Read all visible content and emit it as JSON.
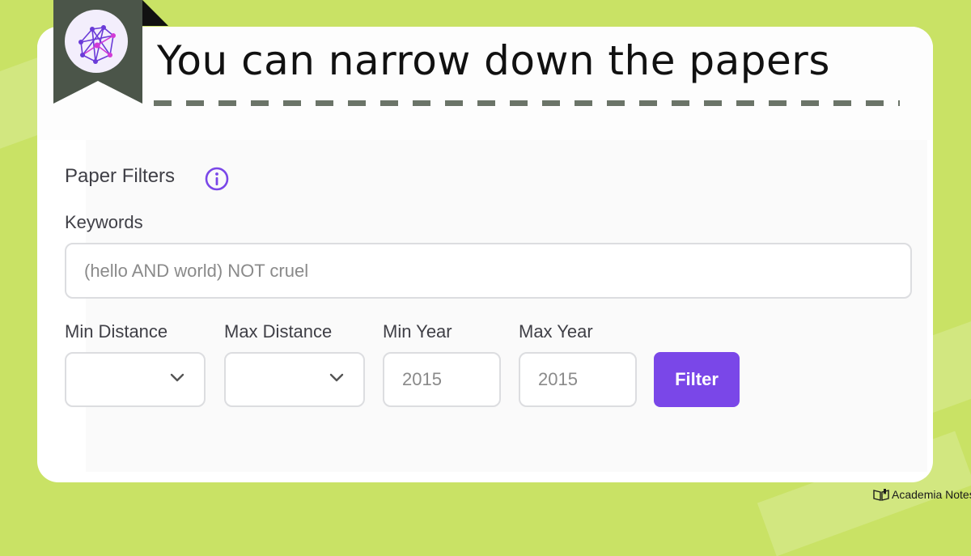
{
  "slide": {
    "title": "You can narrow down the papers",
    "brand": "Academia Notes"
  },
  "panel": {
    "heading": "Paper Filters",
    "keywords_label": "Keywords",
    "keywords_placeholder": "(hello AND world) NOT cruel",
    "min_distance_label": "Min Distance",
    "max_distance_label": "Max Distance",
    "min_year_label": "Min Year",
    "max_year_label": "Max Year",
    "min_year_value": "2015",
    "max_year_value": "2015",
    "filter_button_label": "Filter"
  },
  "colors": {
    "background": "#c9e265",
    "accent": "#7a47e8",
    "bookmark": "#4b5549"
  },
  "icons": [
    "network-logo-icon",
    "info-icon",
    "chevron-down-icon",
    "book-icon"
  ]
}
